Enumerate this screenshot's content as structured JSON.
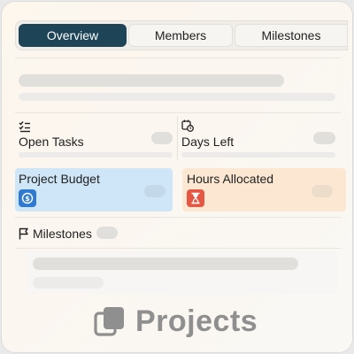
{
  "tabs": [
    {
      "label": "Overview",
      "active": true
    },
    {
      "label": "Members",
      "active": false
    },
    {
      "label": "Milestones",
      "active": false
    }
  ],
  "stats": {
    "open_tasks": {
      "label": "Open Tasks",
      "icon": "checklist-icon"
    },
    "days_left": {
      "label": "Days Left",
      "icon": "calendar-clock-icon"
    }
  },
  "cards": {
    "budget": {
      "label": "Project Budget",
      "icon": "dollar-coin-icon",
      "color": "#cfe6f8",
      "icon_color": "#2f7ad0"
    },
    "hours": {
      "label": "Hours Allocated",
      "icon": "hourglass-icon",
      "color": "#fce8d2",
      "icon_color": "#e45742"
    }
  },
  "milestones": {
    "label": "Milestones",
    "icon": "flag-icon"
  },
  "watermark": {
    "label": "Projects",
    "icon": "copy-windows-icon"
  },
  "colors": {
    "accent": "#1e4457",
    "background": "#fbf6ef"
  }
}
